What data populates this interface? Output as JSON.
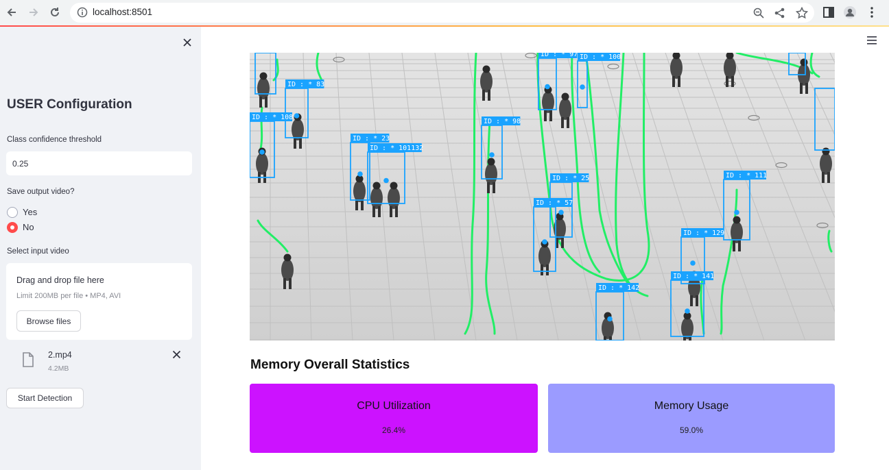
{
  "browser": {
    "url": "localhost:8501"
  },
  "sidebar": {
    "title": "USER Configuration",
    "confidence_label": "Class confidence threshold",
    "confidence_value": "0.25",
    "save_label": "Save output video?",
    "save_options": [
      "Yes",
      "No"
    ],
    "save_selected": "No",
    "input_label": "Select input video",
    "dropzone_title": "Drag and drop file here",
    "dropzone_limit": "Limit 200MB per file • MP4, AVI",
    "browse_label": "Browse files",
    "file_name": "2.mp4",
    "file_size": "4.2MB",
    "start_label": "Start Detection"
  },
  "video": {
    "detections": [
      {
        "label": "ID : * 83"
      },
      {
        "label": "ID : * 108"
      },
      {
        "label": "ID : * 23"
      },
      {
        "label": "ID : * 101132"
      },
      {
        "label": "ID : * 98"
      },
      {
        "label": "ID : * 97"
      },
      {
        "label": "ID : * 100"
      },
      {
        "label": "ID : * 25"
      },
      {
        "label": "ID : * 57"
      },
      {
        "label": "ID : * 111"
      },
      {
        "label": "ID : * 129"
      },
      {
        "label": "ID : * 141"
      },
      {
        "label": "ID : * 142"
      }
    ]
  },
  "stats": {
    "title": "Memory Overall Statistics",
    "cards": [
      {
        "title": "CPU Utilization",
        "value": "26.4%",
        "color": "#cc12ff"
      },
      {
        "title": "Memory Usage",
        "value": "59.0%",
        "color": "#9b9bff"
      }
    ]
  },
  "colors": {
    "accent": "#ff4b4b",
    "box": "#1aa3ff",
    "track": "#22ee66"
  }
}
